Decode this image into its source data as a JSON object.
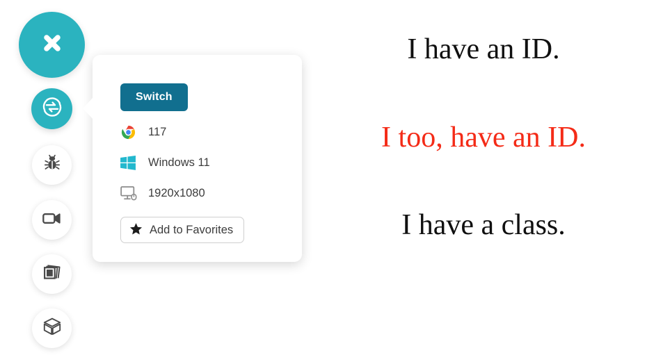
{
  "toolbar": {
    "buttons": [
      {
        "name": "close",
        "icon": "close-x-icon",
        "label": "Close"
      },
      {
        "name": "switch",
        "icon": "switch-arrows-icon",
        "label": "Switch browser"
      },
      {
        "name": "bug",
        "icon": "bug-icon",
        "label": "Report a bug"
      },
      {
        "name": "video",
        "icon": "video-camera-icon",
        "label": "Record video"
      },
      {
        "name": "layers",
        "icon": "stacked-photos-icon",
        "label": "Screenshots"
      },
      {
        "name": "cube",
        "icon": "cube-icon",
        "label": "Local testing"
      }
    ]
  },
  "panel": {
    "switch_label": "Switch",
    "rows": [
      {
        "icon": "chrome-icon",
        "label": "117"
      },
      {
        "icon": "windows-icon",
        "label": "Windows 11"
      },
      {
        "icon": "monitor-icon",
        "label": "1920x1080"
      }
    ],
    "favorites": {
      "icon": "star-icon",
      "label": "Add to Favorites"
    }
  },
  "content": {
    "lines": [
      {
        "text": "I have an ID.",
        "color": "#101010"
      },
      {
        "text": "I too, have an ID.",
        "color": "#f42b17"
      },
      {
        "text": "I have a class.",
        "color": "#101010"
      }
    ]
  },
  "colors": {
    "toolbar_accent": "#2bb3bf",
    "switch_button": "#116f8f",
    "highlight_red": "#f42b17",
    "panel_background": "#ffffff"
  }
}
